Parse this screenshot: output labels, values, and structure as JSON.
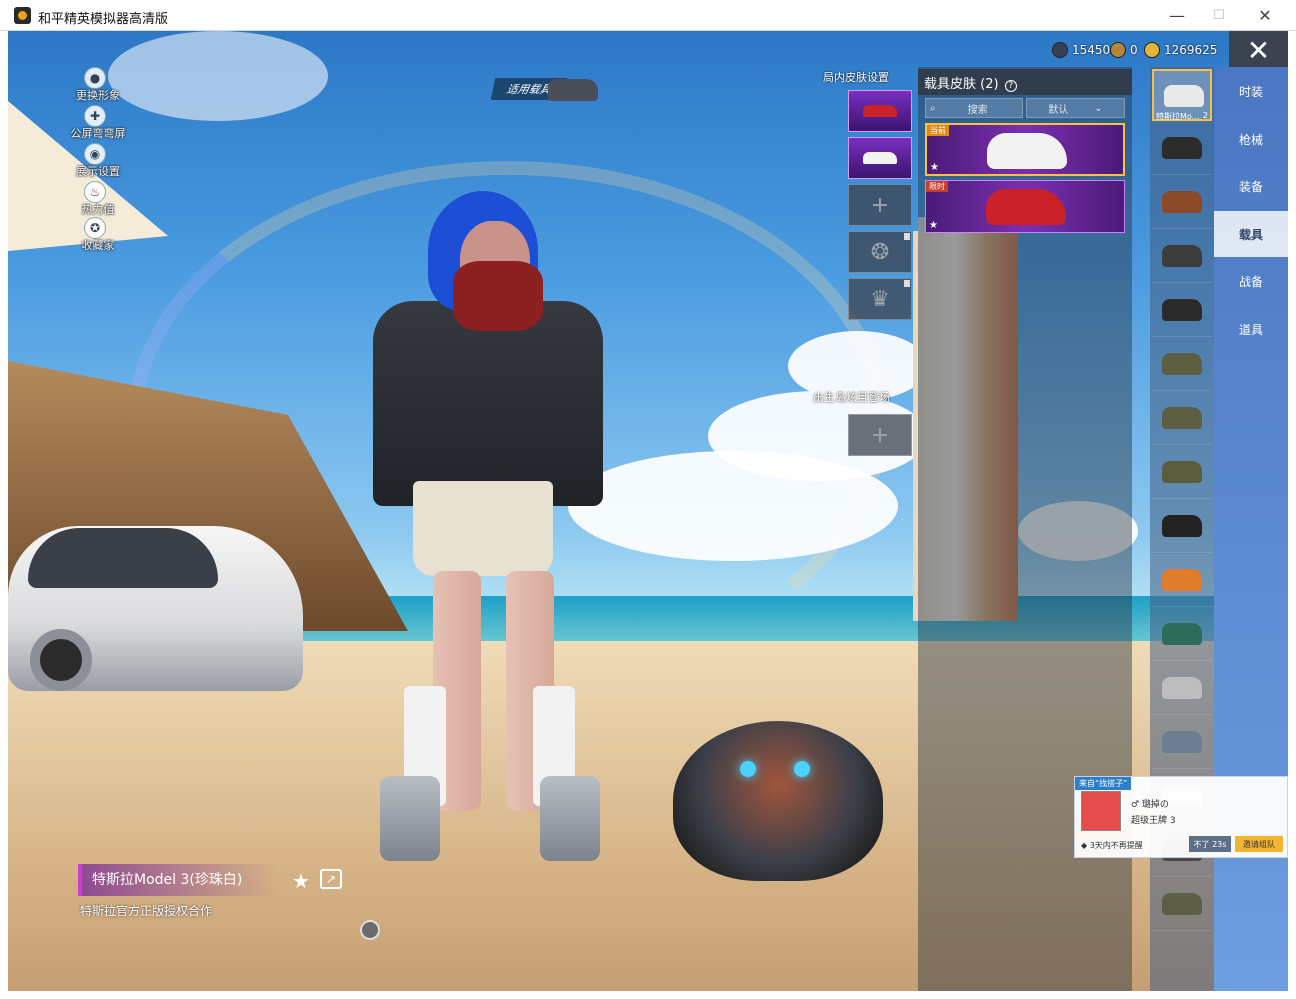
{
  "window": {
    "title": "和平精英模拟器高清版",
    "minimize": "—",
    "maximize": "☐",
    "close": "✕"
  },
  "currencies": [
    {
      "value": "15450",
      "color": "#3a3f58"
    },
    {
      "value": "0",
      "color": "#b5873a"
    },
    {
      "value": "1269625",
      "color": "#e0b53a"
    }
  ],
  "left_menu": [
    {
      "label": "更换形象",
      "icon": "person-icon"
    },
    {
      "label": "公屏弯弯屏",
      "icon": "bubble-icon"
    },
    {
      "label": "展示设置",
      "icon": "eye-icon"
    },
    {
      "label": "热力值",
      "icon": "fire-icon"
    },
    {
      "label": "收藏家",
      "icon": "medal-icon"
    }
  ],
  "top": {
    "apply_vehicle": "适用载具",
    "close": "✕"
  },
  "skin_settings": {
    "label": "局内皮肤设置",
    "plus": "+",
    "spawn_label": "出生岛炫目登场"
  },
  "vehicle_skin_panel": {
    "title": "载具皮肤 (2)",
    "help": "?",
    "search": "搜索",
    "sort": "默认",
    "cards": [
      {
        "car_color": "#f2f2f2",
        "tag": "当前"
      },
      {
        "car_color": "#c9222b",
        "tag": "限时"
      }
    ]
  },
  "vehicle_list": {
    "selected_label": "特斯拉Mo...",
    "selected_count": "2",
    "colors": [
      "#e9e9ea",
      "#2c2c2c",
      "#8a4a28",
      "#3c3c3c",
      "#2a2a2a",
      "#5d5f42",
      "#5d5f42",
      "#5a5d3c",
      "#222222",
      "#e07c2a",
      "#2d6b5a",
      "#bdbdbd",
      "#6f7d92",
      "#cccccc",
      "#4a4a4a",
      "#5c5f45"
    ]
  },
  "categories": [
    {
      "label": "时装",
      "active": false
    },
    {
      "label": "枪械",
      "active": false
    },
    {
      "label": "装备",
      "active": false
    },
    {
      "label": "载具",
      "active": true
    },
    {
      "label": "战备",
      "active": false
    },
    {
      "label": "道具",
      "active": false
    }
  ],
  "invite": {
    "from": "来自“找搭子”",
    "name": "♂ 璐掉の",
    "rank": "超级王牌 3",
    "note": "◆ 3天内不再提醒",
    "decline": "不了 23s",
    "accept": "邀请组队"
  },
  "skin_info": {
    "name": "特斯拉Model 3(珍珠白)",
    "desc": "特斯拉官方正版授权合作",
    "fav": "★",
    "share": "↗"
  }
}
